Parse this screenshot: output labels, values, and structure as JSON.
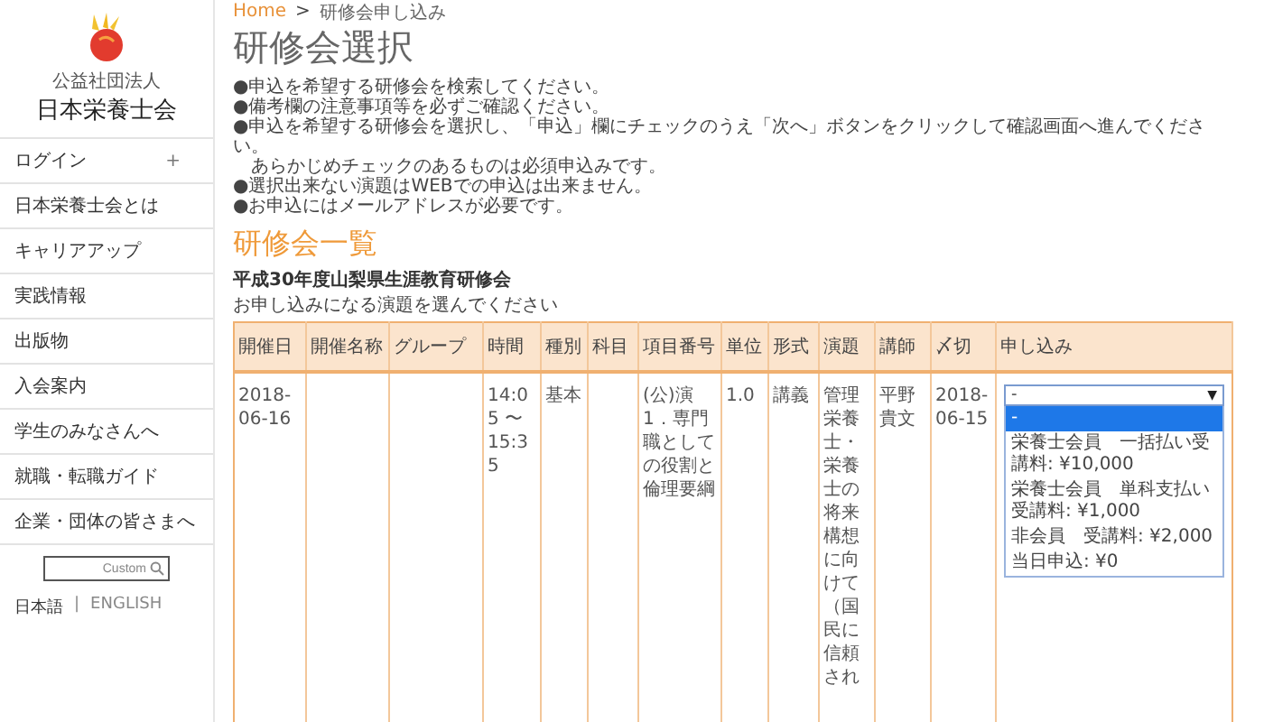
{
  "sidebar": {
    "logo": {
      "subtitle": "公益社団法人",
      "name": "日本栄養士会"
    },
    "items": [
      {
        "label": "ログイン",
        "expander": "+"
      },
      {
        "label": "日本栄養士会とは"
      },
      {
        "label": "キャリアアップ"
      },
      {
        "label": "実践情報"
      },
      {
        "label": "出版物"
      },
      {
        "label": "入会案内"
      },
      {
        "label": "学生のみなさんへ"
      },
      {
        "label": "就職・転職ガイド"
      },
      {
        "label": "企業・団体の皆さまへ"
      }
    ],
    "search": {
      "placeholder": "Custom"
    },
    "languages": [
      {
        "label": "日本語",
        "selected": true
      },
      {
        "label": "ENGLISH",
        "selected": false
      }
    ],
    "language_separator": "|"
  },
  "breadcrumb": [
    {
      "label": "Home",
      "link": true
    },
    {
      "label": "研修会申し込み",
      "link": false
    }
  ],
  "breadcrumb_separator": ">",
  "title": "研修会選択",
  "notes": [
    "●申込を希望する研修会を検索してください。",
    "●備考欄の注意事項等を必ずご確認ください。",
    "●申込を希望する研修会を選択し、「申込」欄にチェックのうえ「次へ」ボタンをクリックして確認画面へ進んでください。",
    "　あらかじめチェックのあるものは必須申込みです。",
    "●選択出来ない演題はWEBでの申込は出来ません。",
    "●お申込にはメールアドレスが必要です。"
  ],
  "section_title": "研修会一覧",
  "event_name": "平成30年度山梨県生涯教育研修会",
  "instruction": "お申し込みになる演題を選んでください",
  "table": {
    "columns": [
      "開催日",
      "開催名称",
      "グループ",
      "時間",
      "種別",
      "科目",
      "項目番号",
      "単位",
      "形式",
      "演題",
      "講師",
      "〆切",
      "申し込み"
    ],
    "rows": [
      {
        "cells": [
          "2018-06-16",
          "",
          "",
          "14:05 〜 15:35",
          "基本",
          "",
          "(公)演1．専門職としての役割と倫理要綱",
          "1.0",
          "講義",
          "管理栄養士・栄養士の将来構想に向けて（国民に信頼され",
          "平野貴文",
          "2018-06-15"
        ],
        "select": {
          "value": "-",
          "caret": "▼",
          "options": [
            {
              "label": "-",
              "selected": true
            },
            {
              "label": "栄養士会員　一括払い受講料: ¥10,000",
              "selected": false
            },
            {
              "label": "栄養士会員　単科支払い受講料: ¥1,000",
              "selected": false
            },
            {
              "label": "非会員　受講料: ¥2,000",
              "selected": false
            },
            {
              "label": "当日申込: ¥0",
              "selected": false
            }
          ]
        }
      }
    ]
  }
}
